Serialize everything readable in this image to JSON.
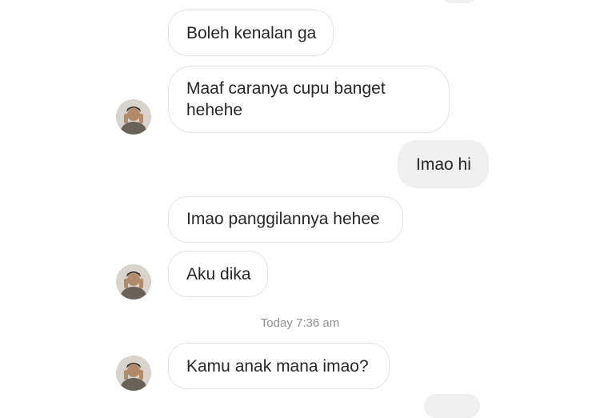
{
  "conversation": {
    "messages": [
      {
        "direction": "in",
        "text": "Boleh kenalan ga"
      },
      {
        "direction": "in",
        "text": "Maaf caranya cupu banget hehehe"
      },
      {
        "direction": "out",
        "text": "Imao hi"
      },
      {
        "direction": "in",
        "text": "Imao panggilannya hehee"
      },
      {
        "direction": "in",
        "text": "Aku dika"
      },
      {
        "direction": "in",
        "text": "Kamu anak mana imao?"
      }
    ],
    "timestamp": "Today 7:36 am"
  },
  "avatar_icon": "user-avatar-photo-icon",
  "colors": {
    "incoming_border": "#e3e3e3",
    "outgoing_bg": "#efefef",
    "text": "#262626",
    "timestamp": "#8e8e8e"
  }
}
